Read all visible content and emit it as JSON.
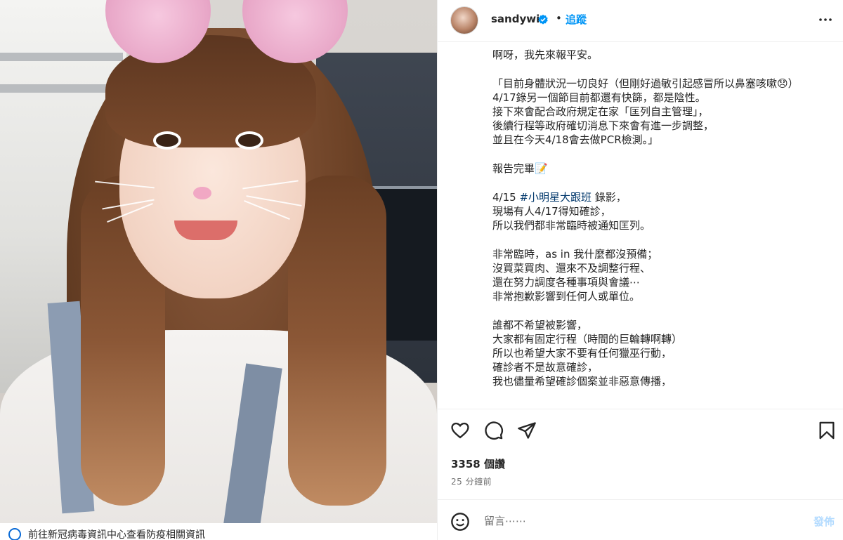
{
  "post": {
    "username": "sandywis",
    "verified": true,
    "separator": "•",
    "follow_label": "追蹤",
    "more_icon": "more-horizontal-icon"
  },
  "caption": {
    "lines": [
      "啊呀，我先來報平安。",
      "",
      "「目前身體狀況一切良好（但剛好過敏引起感冒所以鼻塞咳嗽😞）",
      "4/17錄另一個節目前都還有快篩，都是陰性。",
      "接下來會配合政府規定在家「匡列自主管理」，",
      "後續行程等政府確切消息下來會有進一步調整，",
      "並且在今天4/18會去做PCR檢測。」",
      "",
      "報告完畢📝",
      "",
      "4/15 #小明星大跟班 錄影，",
      "現場有人4/17得知確診，",
      "所以我們都非常臨時被通知匡列。",
      "",
      "非常臨時，as in 我什麼都沒預備；",
      "沒買菜買肉、還來不及調整行程、",
      "還在努力調度各種事項與會議⋯",
      "非常抱歉影響到任何人或單位。",
      "",
      "誰都不希望被影響，",
      "大家都有固定行程（時間的巨輪轉啊轉）",
      "所以也希望大家不要有任何獵巫行動，",
      "確診者不是故意確診，",
      "我也儘量希望確診個案並非惡意傳播，"
    ],
    "hashtag": "#小明星大跟班"
  },
  "actions": {
    "like_icon": "heart-icon",
    "comment_icon": "comment-icon",
    "share_icon": "share-icon",
    "save_icon": "bookmark-icon"
  },
  "stats": {
    "likes": "3358 個讚",
    "time": "25 分鐘前"
  },
  "comment": {
    "placeholder": "留言⋯⋯",
    "post_label": "發佈",
    "emoji_icon": "emoji-icon"
  },
  "image": {
    "banner_text": "前往新冠病毒資訊中心查看防疫相關資訊"
  },
  "colors": {
    "accent": "#0095f6",
    "hashtag": "#00376b",
    "post_disabled": "#b3dbff",
    "text": "#262626",
    "muted": "#737373"
  }
}
